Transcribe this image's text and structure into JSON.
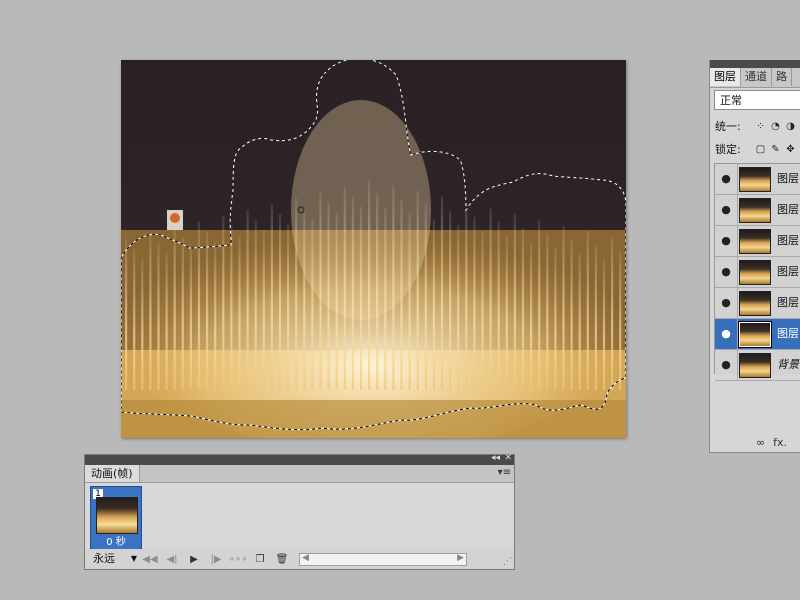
{
  "colors": {
    "workspace": "#b9b9b9",
    "panel": "#d6d6d6",
    "selection": "#3670bd",
    "panel_titlebar": "#4a4a4a"
  },
  "layers_panel": {
    "tabs": [
      {
        "label": "图层",
        "active": true
      },
      {
        "label": "通道",
        "active": false
      },
      {
        "label": "路",
        "active": false
      }
    ],
    "blend_mode": "正常",
    "unify_label": "统一:",
    "lock_label": "锁定:",
    "layers": [
      {
        "name": "图层",
        "visible": true,
        "selected": false
      },
      {
        "name": "图层",
        "visible": true,
        "selected": false
      },
      {
        "name": "图层",
        "visible": true,
        "selected": false
      },
      {
        "name": "图层",
        "visible": true,
        "selected": false
      },
      {
        "name": "图层",
        "visible": true,
        "selected": false
      },
      {
        "name": "图层",
        "visible": true,
        "selected": true
      },
      {
        "name": "背景",
        "visible": true,
        "selected": false
      }
    ],
    "footer_icons": [
      "link-icon",
      "fx-icon"
    ],
    "fx_label": "fx."
  },
  "animation_panel": {
    "tab_label": "动画(帧)",
    "frames": [
      {
        "number": "1",
        "delay": "0 秒",
        "selected": true
      }
    ],
    "loop_option": "永远"
  }
}
